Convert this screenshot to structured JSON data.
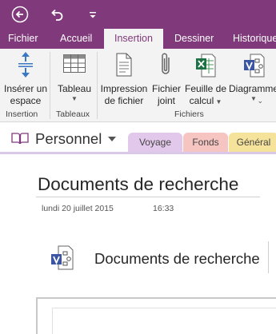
{
  "app": {
    "accent": "#80397b",
    "ribbon_bg": "#f3f3f3"
  },
  "titlebar": {
    "back_icon": "back-arrow-icon",
    "undo_icon": "undo-icon",
    "more_icon": "quick-access-more-icon"
  },
  "tabs": [
    {
      "label": "Fichier",
      "active": false
    },
    {
      "label": "Accueil",
      "active": false
    },
    {
      "label": "Insertion",
      "active": true
    },
    {
      "label": "Dessiner",
      "active": false
    },
    {
      "label": "Historique",
      "active": false
    }
  ],
  "ribbon": {
    "insert_space": {
      "line1": "Insérer un",
      "line2": "espace",
      "icon": "insert-space-icon"
    },
    "table": {
      "label": "Tableau",
      "icon": "table-icon"
    },
    "file_printout": {
      "line1": "Impression",
      "line2": "de fichier",
      "icon": "file-printout-icon"
    },
    "file_attach": {
      "line1": "Fichier",
      "line2": "joint",
      "icon": "paperclip-icon"
    },
    "spreadsheet": {
      "line1": "Feuille de",
      "line2": "calcul",
      "icon": "excel-icon"
    },
    "diagram": {
      "line1": "Diagramme",
      "icon": "visio-icon"
    },
    "groups": {
      "insertion": "Insertion",
      "tables": "Tableaux",
      "files": "Fichiers"
    }
  },
  "notebook": {
    "name": "Personnel",
    "sections": [
      {
        "label": "Voyage",
        "color": "#e2c8ea"
      },
      {
        "label": "Fonds",
        "color": "#f6c4c1"
      },
      {
        "label": "Général",
        "color": "#f6e39b"
      }
    ]
  },
  "page": {
    "title": "Documents de recherche",
    "date": "lundi 20 juillet 2015",
    "time": "16:33",
    "embedded_file": {
      "label": "Documents de recherche",
      "icon": "visio-file-icon"
    }
  }
}
